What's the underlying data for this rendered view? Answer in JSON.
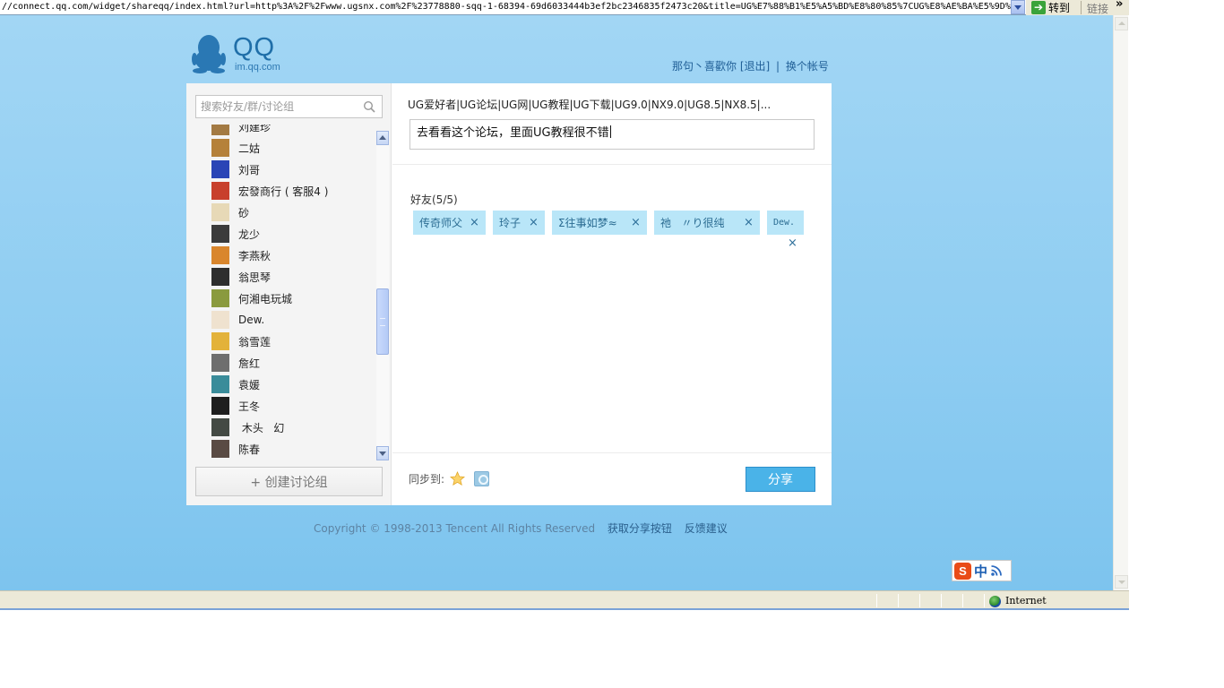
{
  "browser": {
    "address": "//connect.qq.com/widget/shareqq/index.html?url=http%3A%2F%2Fwww.ugsnx.com%2F%23778880-sqq-1-68394-69d6033444b3ef2bc2346835f2473c20&title=UG%E7%88%B1%E5%A5%BD%E8%80%85%7CUG%E8%AE%BA%E5%9D%9",
    "go_label": "转到",
    "links_label": "链接",
    "more_glyph": "»",
    "status_zone": "Internet"
  },
  "logo": {
    "name": "QQ",
    "domain": "im.qq.com"
  },
  "userbar": {
    "nickname": "那句丶喜歡你",
    "logout": "[退出]",
    "separator": "|",
    "switch": "换个帐号"
  },
  "sidebar": {
    "search_placeholder": "搜索好友/群/讨论组",
    "partial_top": "刘建珍",
    "friends": [
      {
        "name": "二姑",
        "avatar": "#b5813a"
      },
      {
        "name": "刘哥",
        "avatar": "#2a45b6"
      },
      {
        "name": "宏發商行 ( 客服4 )",
        "avatar": "#c8402c"
      },
      {
        "name": "砂",
        "avatar": "#e7d9b7"
      },
      {
        "name": "龙少",
        "avatar": "#3b3b3b"
      },
      {
        "name": "李燕秋",
        "avatar": "#d9862d"
      },
      {
        "name": "翁思琴",
        "avatar": "#2e2e2e"
      },
      {
        "name": "何湘电玩城",
        "avatar": "#8a9a3e"
      },
      {
        "name": "Dew.",
        "avatar": "#efe2cf"
      },
      {
        "name": "翁雪莲",
        "avatar": "#e3b23a"
      },
      {
        "name": "詹红",
        "avatar": "#6e6e6e"
      },
      {
        "name": "袁媛",
        "avatar": "#3a8c9a"
      },
      {
        "name": "王冬",
        "avatar": "#1e1e1e"
      },
      {
        "name": " 木头   幻",
        "avatar": "#444a44"
      },
      {
        "name": "陈春",
        "avatar": "#5a4b44"
      }
    ],
    "create_group": "+ 创建讨论组"
  },
  "share": {
    "title": "UG爱好者|UG论坛|UG网|UG教程|UG下载|UG9.0|NX9.0|UG8.5|NX8.5|...",
    "comment": "去看看这个论坛，里面UG教程很不错",
    "friends_label": "好友(5/5)",
    "selected": [
      "传奇师父",
      "玲子",
      "Σ往事如梦≈",
      "祂   〃り很纯",
      "Dew."
    ],
    "remove_glyph": "×",
    "sync_label": "同步到:",
    "share_button": "分享"
  },
  "footer": {
    "copyright": "Copyright © 1998-2013 Tencent All Rights Reserved",
    "get_button": "获取分享按钮",
    "feedback": "反馈建议"
  },
  "ime": {
    "logo": "S",
    "mode": "中"
  },
  "colors": {
    "page_bg": "#8fcdf2",
    "share_button": "#4ab3e8",
    "tag_bg": "#b9e6f8"
  }
}
